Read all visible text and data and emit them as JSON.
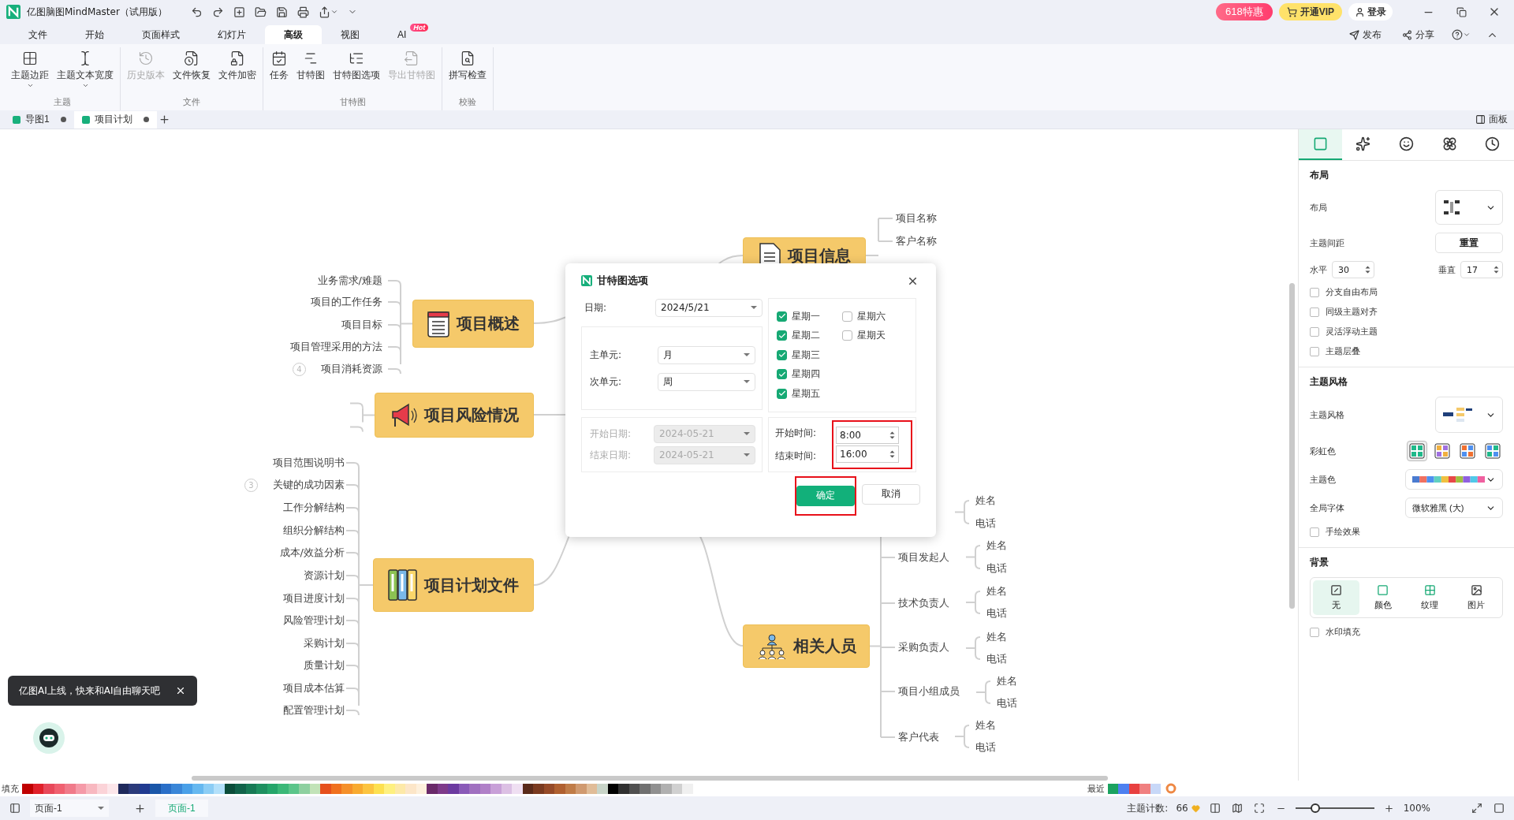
{
  "app": {
    "title": "亿图脑图MindMaster（试用版）",
    "promo": "618特惠",
    "vip": "开通VIP",
    "login": "登录"
  },
  "menu": {
    "tabs": [
      {
        "label": "文件",
        "selected": false
      },
      {
        "label": "开始",
        "selected": false
      },
      {
        "label": "页面样式",
        "selected": false
      },
      {
        "label": "幻灯片",
        "selected": false
      },
      {
        "label": "高级",
        "selected": true
      },
      {
        "label": "视图",
        "selected": false
      },
      {
        "label": "AI",
        "selected": false,
        "badge": "Hot"
      }
    ],
    "actions": [
      {
        "label": "发布"
      },
      {
        "label": "分享"
      }
    ]
  },
  "ribbon": {
    "groups": [
      {
        "label": "主题",
        "items": [
          {
            "label": "主题边距",
            "disabled": false,
            "dropdown": true
          },
          {
            "label": "主题文本宽度",
            "disabled": false,
            "dropdown": true
          }
        ]
      },
      {
        "label": "文件",
        "items": [
          {
            "label": "历史版本",
            "disabled": true,
            "dropdown": false
          },
          {
            "label": "文件恢复",
            "disabled": false,
            "dropdown": false
          },
          {
            "label": "文件加密",
            "disabled": false,
            "dropdown": false
          }
        ]
      },
      {
        "label": "甘特图",
        "items": [
          {
            "label": "任务",
            "disabled": false,
            "dropdown": false
          },
          {
            "label": "甘特图",
            "disabled": false,
            "dropdown": false
          },
          {
            "label": "甘特图选项",
            "disabled": false,
            "dropdown": false
          },
          {
            "label": "导出甘特图",
            "disabled": true,
            "dropdown": false
          }
        ]
      },
      {
        "label": "校验",
        "items": [
          {
            "label": "拼写检查",
            "disabled": false,
            "dropdown": false
          }
        ]
      }
    ]
  },
  "doc_tabs": [
    {
      "label": "导图1",
      "selected": false
    },
    {
      "label": "项目计划",
      "selected": true
    }
  ],
  "panel_toggle": "面板",
  "mind_map": {
    "topics": [
      {
        "title": "项目概述",
        "children": [
          {
            "text": "业务需求/难题"
          },
          {
            "text": "项目的工作任务"
          },
          {
            "text": "项目目标"
          },
          {
            "text": "项目管理采用的方法"
          },
          {
            "text": "项目消耗资源",
            "collapsed_count": "4"
          }
        ]
      },
      {
        "title": "项目风险情况"
      },
      {
        "title": "项目计划文件",
        "children": [
          {
            "text": "项目范围说明书"
          },
          {
            "text": "关键的成功因素",
            "collapsed_count": "3"
          },
          {
            "text": "工作分解结构"
          },
          {
            "text": "组织分解结构"
          },
          {
            "text": "成本/效益分析"
          },
          {
            "text": "资源计划"
          },
          {
            "text": "项目进度计划"
          },
          {
            "text": "风险管理计划"
          },
          {
            "text": "采购计划"
          },
          {
            "text": "质量计划"
          },
          {
            "text": "项目成本估算"
          },
          {
            "text": "配置管理计划"
          }
        ]
      },
      {
        "title": "项目信息",
        "children": [
          {
            "text": "项目名称"
          },
          {
            "text": "客户名称"
          }
        ]
      },
      {
        "title": "相关人员",
        "children": [
          {
            "children": [
              {
                "text": "姓名"
              },
              {
                "text": "电话"
              }
            ]
          },
          {
            "text": "项目发起人",
            "children": [
              {
                "text": "姓名"
              },
              {
                "text": "电话"
              }
            ]
          },
          {
            "text": "技术负责人",
            "children": [
              {
                "text": "姓名"
              },
              {
                "text": "电话"
              }
            ]
          },
          {
            "text": "采购负责人",
            "children": [
              {
                "text": "姓名"
              },
              {
                "text": "电话"
              }
            ]
          },
          {
            "text": "项目小组成员",
            "children": [
              {
                "text": "姓名"
              },
              {
                "text": "电话"
              }
            ]
          },
          {
            "text": "客户代表",
            "children": [
              {
                "text": "姓名"
              },
              {
                "text": "电话"
              }
            ]
          }
        ]
      }
    ]
  },
  "dialog": {
    "title": "甘特图选项",
    "date_label": "日期:",
    "date": "2024/5/21",
    "major_label": "主单元:",
    "major": "月",
    "minor_label": "次单元:",
    "minor": "周",
    "start_date_label": "开始日期:",
    "start_date": "2024-05-21",
    "end_date_label": "结束日期:",
    "end_date": "2024-05-21",
    "range_disabled": true,
    "weekdays": [
      {
        "label": "星期一",
        "checked": true
      },
      {
        "label": "星期二",
        "checked": true
      },
      {
        "label": "星期三",
        "checked": true
      },
      {
        "label": "星期四",
        "checked": true
      },
      {
        "label": "星期五",
        "checked": true
      },
      {
        "label": "星期六",
        "checked": false
      },
      {
        "label": "星期天",
        "checked": false
      }
    ],
    "start_time_label": "开始时间:",
    "start_time": "8:00",
    "end_time_label": "结束时间:",
    "end_time": "16:00",
    "ok": "确定",
    "cancel": "取消"
  },
  "side_panel": {
    "tabs": [
      {
        "selected": true
      },
      {
        "selected": false
      },
      {
        "selected": false
      },
      {
        "selected": false
      },
      {
        "selected": false
      }
    ],
    "layout_title": "布局",
    "layout_label": "布局",
    "spacing_label": "主题间距",
    "reset": "重置",
    "horizontal_label": "水平",
    "horizontal": "30",
    "vertical_label": "垂直",
    "vertical": "17",
    "layout_options": [
      {
        "label": "分支自由布局",
        "checked": false
      },
      {
        "label": "同级主题对齐",
        "checked": false
      },
      {
        "label": "灵活浮动主题",
        "checked": false
      },
      {
        "label": "主题层叠",
        "checked": false
      }
    ],
    "style_title": "主题风格",
    "style_label": "主题风格",
    "rainbow_label": "彩虹色",
    "rainbow": [
      {
        "selected": true
      },
      {
        "selected": false
      },
      {
        "selected": false
      },
      {
        "selected": false
      }
    ],
    "theme_color_label": "主题色",
    "font_label": "全局字体",
    "font": "微软雅黑 (大)",
    "hand_drawn": {
      "label": "手绘效果",
      "checked": false
    },
    "background_title": "背景",
    "backgrounds": [
      {
        "label": "无",
        "selected": true
      },
      {
        "label": "颜色",
        "selected": false
      },
      {
        "label": "纹理",
        "selected": false
      },
      {
        "label": "图片",
        "selected": false
      }
    ],
    "watermark": {
      "label": "水印填充",
      "checked": false
    }
  },
  "ai_tip": {
    "text": "亿图AI上线，快来和AI自由聊天吧"
  },
  "palette": {
    "label": "填充",
    "swatches": [
      {
        "color": "#c00000"
      },
      {
        "color": "#e0202a"
      },
      {
        "color": "#e8485a"
      },
      {
        "color": "#f06070"
      },
      {
        "color": "#f07a8a"
      },
      {
        "color": "#f59aa8"
      },
      {
        "color": "#f8b8c0"
      },
      {
        "color": "#fbd3d8"
      },
      {
        "color": "#fce6ea"
      },
      {
        "color": "#1f2a5c"
      },
      {
        "color": "#2b3a7a"
      },
      {
        "color": "#203a90"
      },
      {
        "color": "#1a56a8"
      },
      {
        "color": "#2a6fc8"
      },
      {
        "color": "#3a86d8"
      },
      {
        "color": "#4aa0e8"
      },
      {
        "color": "#66b8f0"
      },
      {
        "color": "#8ccdf5"
      },
      {
        "color": "#b3e0fa"
      },
      {
        "color": "#0b4d3a"
      },
      {
        "color": "#11634a"
      },
      {
        "color": "#177a55"
      },
      {
        "color": "#1e9060"
      },
      {
        "color": "#25a56a"
      },
      {
        "color": "#3bb878"
      },
      {
        "color": "#5bc58a"
      },
      {
        "color": "#8ed0a0"
      },
      {
        "color": "#c2e3b8"
      },
      {
        "color": "#e6501c"
      },
      {
        "color": "#f0701e"
      },
      {
        "color": "#f5902a"
      },
      {
        "color": "#f8aa30"
      },
      {
        "color": "#fcc440"
      },
      {
        "color": "#fde050"
      },
      {
        "color": "#fef080"
      },
      {
        "color": "#fde9a8"
      },
      {
        "color": "#fce6c8"
      },
      {
        "color": "#fdf0dc"
      },
      {
        "color": "#6a2a6a"
      },
      {
        "color": "#7e3a8a"
      },
      {
        "color": "#6c3aa0"
      },
      {
        "color": "#8a5ab8"
      },
      {
        "color": "#a070c0"
      },
      {
        "color": "#b080c8"
      },
      {
        "color": "#c8a0d8"
      },
      {
        "color": "#dcc0e4"
      },
      {
        "color": "#efdff2"
      },
      {
        "color": "#5a2a1a"
      },
      {
        "color": "#7a3a20"
      },
      {
        "color": "#964a28"
      },
      {
        "color": "#b06030"
      },
      {
        "color": "#c07c48"
      },
      {
        "color": "#d09a70"
      },
      {
        "color": "#e0bc98"
      },
      {
        "color": "#c8d4c8"
      },
      {
        "color": "#000000"
      },
      {
        "color": "#303030"
      },
      {
        "color": "#505050"
      },
      {
        "color": "#707070"
      },
      {
        "color": "#909090"
      },
      {
        "color": "#b0b0b0"
      },
      {
        "color": "#d0d0d0"
      },
      {
        "color": "#f0f0f0"
      }
    ],
    "recent_label": "最近",
    "recent": [
      {
        "color": "#1aa260"
      },
      {
        "color": "#4e80f0"
      },
      {
        "color": "#e84040"
      },
      {
        "color": "#f08080"
      },
      {
        "color": "#c8d8f8"
      }
    ]
  },
  "status_bar": {
    "page_menu": "页面-1",
    "pages": [
      {
        "label": "页面-1",
        "selected": true
      }
    ],
    "count_label": "主题计数:",
    "count": "66",
    "zoom": {
      "level": 0.25
    },
    "zoom_text": "100%"
  }
}
